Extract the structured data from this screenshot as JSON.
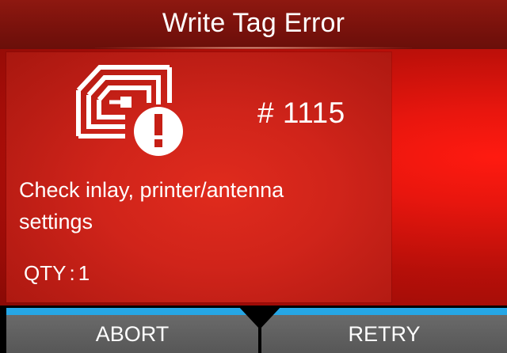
{
  "header": {
    "title": "Write Tag Error"
  },
  "error": {
    "icon": "rfid-tag-error-icon",
    "code": "# 1115",
    "message_line1": "Check inlay, printer/antenna",
    "message_line2": "settings"
  },
  "quantity": {
    "label": "QTY",
    "separator": ":",
    "value": "1"
  },
  "softkeys": {
    "left_label": "ABORT",
    "right_label": "RETRY"
  },
  "colors": {
    "header_bg": "#7a120c",
    "error_red": "#d0241a",
    "accent_blue": "#26a7e6",
    "softkey_gray": "#626262",
    "text": "#ffffff"
  }
}
